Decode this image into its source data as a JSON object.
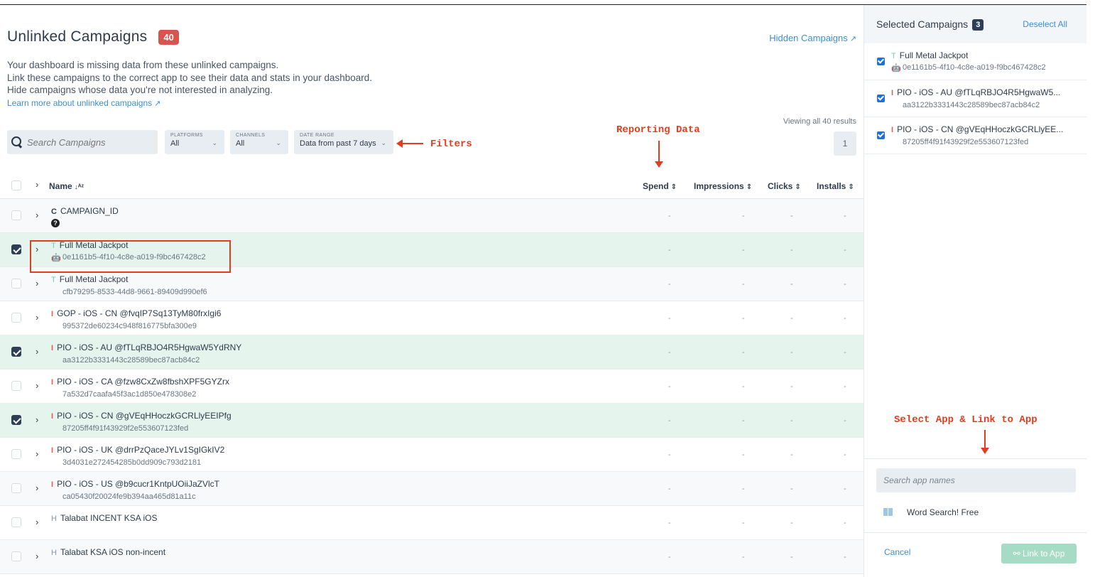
{
  "header": {
    "title": "Unlinked Campaigns",
    "count": "40",
    "hidden_link": "Hidden Campaigns",
    "description": [
      "Your dashboard is missing data from these unlinked campaigns.",
      "Link these campaigns to the correct app to see their data and stats in your dashboard.",
      "Hide campaigns whose data you're not interested in analyzing."
    ],
    "learn_more": "Learn more about unlinked campaigns"
  },
  "filters": {
    "search_placeholder": "Search Campaigns",
    "platforms": {
      "label": "PLATFORMS",
      "value": "All"
    },
    "channels": {
      "label": "CHANNELS",
      "value": "All"
    },
    "date_range": {
      "label": "DATE RANGE",
      "value": "Data from past 7 days"
    }
  },
  "results": {
    "viewing": "Viewing all 40 results",
    "page": "1"
  },
  "annotations": {
    "filters": "Filters",
    "reporting": "Reporting Data",
    "select_link": "Select App & Link to App"
  },
  "table": {
    "columns": {
      "name": "Name",
      "spend": "Spend",
      "impressions": "Impressions",
      "clicks": "Clicks",
      "installs": "Installs"
    },
    "rows": [
      {
        "letter": "C",
        "name": "CAMPAIGN_ID",
        "id": "",
        "platform": "unknown",
        "selected": false,
        "spend": "-",
        "impressions": "-",
        "clicks": "-",
        "installs": "-"
      },
      {
        "letter": "T",
        "name": "Full Metal Jackpot",
        "id": "0e1161b5-4f10-4c8e-a019-f9bc467428c2",
        "platform": "android",
        "selected": true,
        "spend": "-",
        "impressions": "-",
        "clicks": "-",
        "installs": "-"
      },
      {
        "letter": "T",
        "name": "Full Metal Jackpot",
        "id": "cfb79295-8533-44d8-9661-89409d990ef6",
        "platform": "ios",
        "selected": false,
        "spend": "-",
        "impressions": "-",
        "clicks": "-",
        "installs": "-"
      },
      {
        "letter": "I",
        "name": "GOP - iOS - CN @fvqIP7Sq13TyM80frxIgi6",
        "id": "995372de60234c948f816775bfa300e9",
        "platform": "ios",
        "selected": false,
        "spend": "-",
        "impressions": "-",
        "clicks": "-",
        "installs": "-"
      },
      {
        "letter": "I",
        "name": "PIO - iOS - AU @fTLqRBJO4R5HgwaW5YdRNY",
        "id": "aa3122b3331443c28589bec87acb84c2",
        "platform": "ios",
        "selected": true,
        "spend": "-",
        "impressions": "-",
        "clicks": "-",
        "installs": "-"
      },
      {
        "letter": "I",
        "name": "PIO - iOS - CA @fzw8CxZw8fbshXPF5GYZrx",
        "id": "7a532d7caafa45f3ac1d850e478308e2",
        "platform": "ios",
        "selected": false,
        "spend": "-",
        "impressions": "-",
        "clicks": "-",
        "installs": "-"
      },
      {
        "letter": "I",
        "name": "PIO - iOS - CN @gVEqHHoczkGCRLlyEEIPfg",
        "id": "87205ff4f91f43929f2e553607123fed",
        "platform": "ios",
        "selected": true,
        "spend": "-",
        "impressions": "-",
        "clicks": "-",
        "installs": "-"
      },
      {
        "letter": "I",
        "name": "PIO - iOS - UK @drrPzQaceJYLv1SgIGkIV2",
        "id": "3d4031e272454285b0dd909c793d2181",
        "platform": "ios",
        "selected": false,
        "spend": "-",
        "impressions": "-",
        "clicks": "-",
        "installs": "-"
      },
      {
        "letter": "I",
        "name": "PIO - iOS - US @b9cucr1KntpUOiiJaZVlcT",
        "id": "ca05430f20024fe9b394aa465d81a11c",
        "platform": "ios",
        "selected": false,
        "spend": "-",
        "impressions": "-",
        "clicks": "-",
        "installs": "-"
      },
      {
        "letter": "H",
        "name": "Talabat INCENT KSA iOS",
        "id": "",
        "platform": "ios",
        "selected": false,
        "spend": "-",
        "impressions": "-",
        "clicks": "-",
        "installs": "-"
      },
      {
        "letter": "H",
        "name": "Talabat KSA iOS non-incent",
        "id": "",
        "platform": "ios",
        "selected": false,
        "spend": "-",
        "impressions": "-",
        "clicks": "-",
        "installs": "-"
      }
    ]
  },
  "selected_panel": {
    "title": "Selected Campaigns",
    "count": "3",
    "deselect_all": "Deselect All",
    "items": [
      {
        "letter": "T",
        "name": "Full Metal Jackpot",
        "id": "0e1161b5-4f10-4c8e-a019-f9bc467428c2",
        "platform": "android"
      },
      {
        "letter": "I",
        "name": "PIO - iOS - AU @fTLqRBJO4R5HgwaW5...",
        "id": "aa3122b3331443c28589bec87acb84c2",
        "platform": "ios"
      },
      {
        "letter": "I",
        "name": "PIO - iOS - CN @gVEqHHoczkGCRLlyEE...",
        "id": "87205ff4f91f43929f2e553607123fed",
        "platform": "ios"
      }
    ],
    "app_search_placeholder": "Search app names",
    "app_result": "Word Search! Free",
    "cancel": "Cancel",
    "link_button": "Link to App"
  },
  "colors": {
    "accent_blue": "#3b8fd6",
    "badge_red": "#d9534f",
    "selected_row": "#e6f4ee",
    "annotation_red": "#e23d1f",
    "link_button": "#a6dcc6"
  }
}
